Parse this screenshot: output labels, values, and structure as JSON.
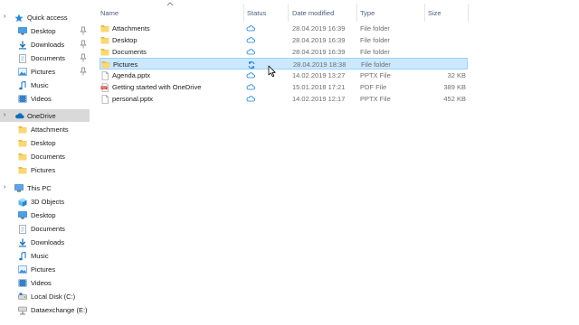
{
  "nav": {
    "items": [
      {
        "label": "Quick access",
        "icon": "star-icon",
        "level": 0,
        "pinned": false
      },
      {
        "label": "Desktop",
        "icon": "desktop-icon",
        "level": 1,
        "pinned": true
      },
      {
        "label": "Downloads",
        "icon": "download-icon",
        "level": 1,
        "pinned": true
      },
      {
        "label": "Documents",
        "icon": "documents-icon",
        "level": 1,
        "pinned": true
      },
      {
        "label": "Pictures",
        "icon": "pictures-icon",
        "level": 1,
        "pinned": true
      },
      {
        "label": "Music",
        "icon": "music-icon",
        "level": 1,
        "pinned": false
      },
      {
        "label": "Videos",
        "icon": "videos-icon",
        "level": 1,
        "pinned": false
      },
      {
        "label": "OneDrive",
        "icon": "cloud-icon",
        "level": 0,
        "pinned": false,
        "selected": true
      },
      {
        "label": "Attachments",
        "icon": "folder-icon",
        "level": 1,
        "pinned": false
      },
      {
        "label": "Desktop",
        "icon": "folder-icon",
        "level": 1,
        "pinned": false
      },
      {
        "label": "Documents",
        "icon": "folder-icon",
        "level": 1,
        "pinned": false
      },
      {
        "label": "Pictures",
        "icon": "folder-icon",
        "level": 1,
        "pinned": false
      },
      {
        "label": "This PC",
        "icon": "computer-icon",
        "level": 0,
        "pinned": false
      },
      {
        "label": "3D Objects",
        "icon": "cube-icon",
        "level": 1,
        "pinned": false
      },
      {
        "label": "Desktop",
        "icon": "desktop-icon",
        "level": 1,
        "pinned": false
      },
      {
        "label": "Documents",
        "icon": "documents-icon",
        "level": 1,
        "pinned": false
      },
      {
        "label": "Downloads",
        "icon": "download-icon",
        "level": 1,
        "pinned": false
      },
      {
        "label": "Music",
        "icon": "music-icon",
        "level": 1,
        "pinned": false
      },
      {
        "label": "Pictures",
        "icon": "pictures-icon",
        "level": 1,
        "pinned": false
      },
      {
        "label": "Videos",
        "icon": "videos-icon",
        "level": 1,
        "pinned": false
      },
      {
        "label": "Local Disk (C:)",
        "icon": "drive-icon",
        "level": 1,
        "pinned": false
      },
      {
        "label": "Dataexchange (E:)",
        "icon": "network-drive-icon",
        "level": 1,
        "pinned": false
      }
    ]
  },
  "columns": {
    "name": "Name",
    "status": "Status",
    "date": "Date modified",
    "type": "Type",
    "size": "Size"
  },
  "files": [
    {
      "name": "Attachments",
      "status": "cloud",
      "date": "28.04.2019 16:39",
      "type": "File folder",
      "size": "",
      "icon": "folder-icon"
    },
    {
      "name": "Desktop",
      "status": "cloud",
      "date": "28.04.2019 16:39",
      "type": "File folder",
      "size": "",
      "icon": "folder-icon"
    },
    {
      "name": "Documents",
      "status": "cloud",
      "date": "28.04.2019 16:39",
      "type": "File folder",
      "size": "",
      "icon": "folder-icon"
    },
    {
      "name": "Pictures",
      "status": "sync",
      "date": "28.04.2019 18:38",
      "type": "File folder",
      "size": "",
      "icon": "folder-icon",
      "selected": true
    },
    {
      "name": "Agenda.pptx",
      "status": "cloud",
      "date": "14.02.2019 13:27",
      "type": "PPTX File",
      "size": "32 KB",
      "icon": "file-icon"
    },
    {
      "name": "Getting started with OneDrive",
      "status": "cloud",
      "date": "15.01.2018 17:21",
      "type": "PDF File",
      "size": "389 KB",
      "icon": "pdf-icon"
    },
    {
      "name": "personal.pptx",
      "status": "cloud",
      "date": "14.02.2019 12:17",
      "type": "PPTX File",
      "size": "452 KB",
      "icon": "file-icon"
    }
  ],
  "colors": {
    "selection_bg": "#cce8ff",
    "selection_border": "#99d1ff",
    "nav_selected": "#d9d9d9",
    "folder": "#f8d775",
    "accent": "#0078d7",
    "header_text": "#4c607a"
  }
}
